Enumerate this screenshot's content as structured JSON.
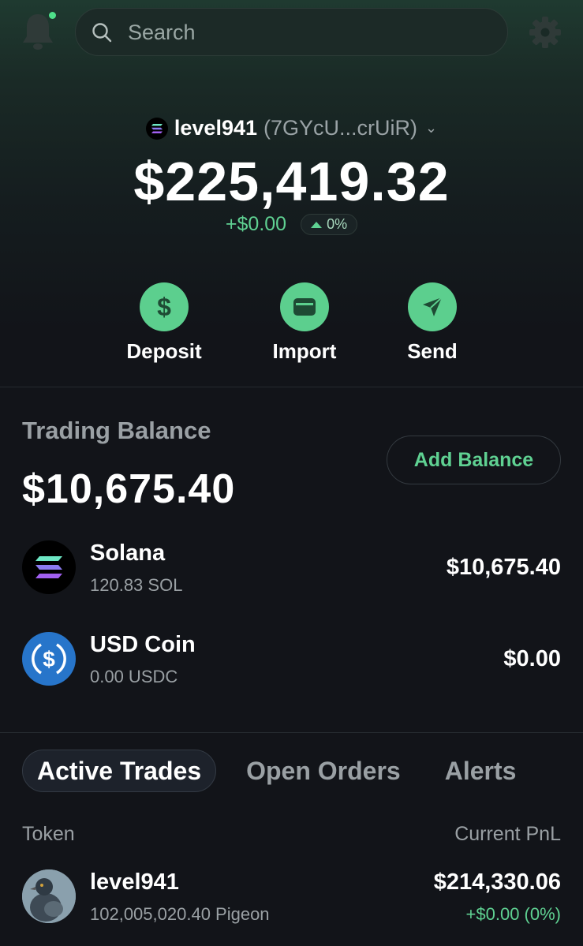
{
  "header": {
    "search_placeholder": "Search",
    "notification_dot_color": "#4ee08a"
  },
  "account": {
    "name": "level941",
    "address": "(7GYcU...crUiR)",
    "total_balance": "$225,419.32",
    "change_value": "+$0.00",
    "change_percent": "0%"
  },
  "actions": [
    {
      "label": "Deposit",
      "icon": "dollar-icon"
    },
    {
      "label": "Import",
      "icon": "wallet-icon"
    },
    {
      "label": "Send",
      "icon": "send-icon"
    }
  ],
  "trading_balance": {
    "title": "Trading Balance",
    "value": "$10,675.40",
    "add_label": "Add Balance",
    "assets": [
      {
        "name": "Solana",
        "amount": "120.83 SOL",
        "value": "$10,675.40",
        "icon": "solana-icon"
      },
      {
        "name": "USD Coin",
        "amount": "0.00 USDC",
        "value": "$0.00",
        "icon": "usdc-icon"
      }
    ]
  },
  "tabs": [
    {
      "label": "Active Trades",
      "active": true
    },
    {
      "label": "Open Orders",
      "active": false
    },
    {
      "label": "Alerts",
      "active": false
    }
  ],
  "table": {
    "col_token": "Token",
    "col_pnl": "Current PnL",
    "rows": [
      {
        "name": "level941",
        "amount": "102,005,020.40 Pigeon",
        "pnl": "$214,330.06",
        "change": "+$0.00 (0%)"
      }
    ]
  },
  "colors": {
    "accent_green": "#5ccf8e",
    "background": "#121419",
    "usdc_blue": "#2775ca"
  }
}
